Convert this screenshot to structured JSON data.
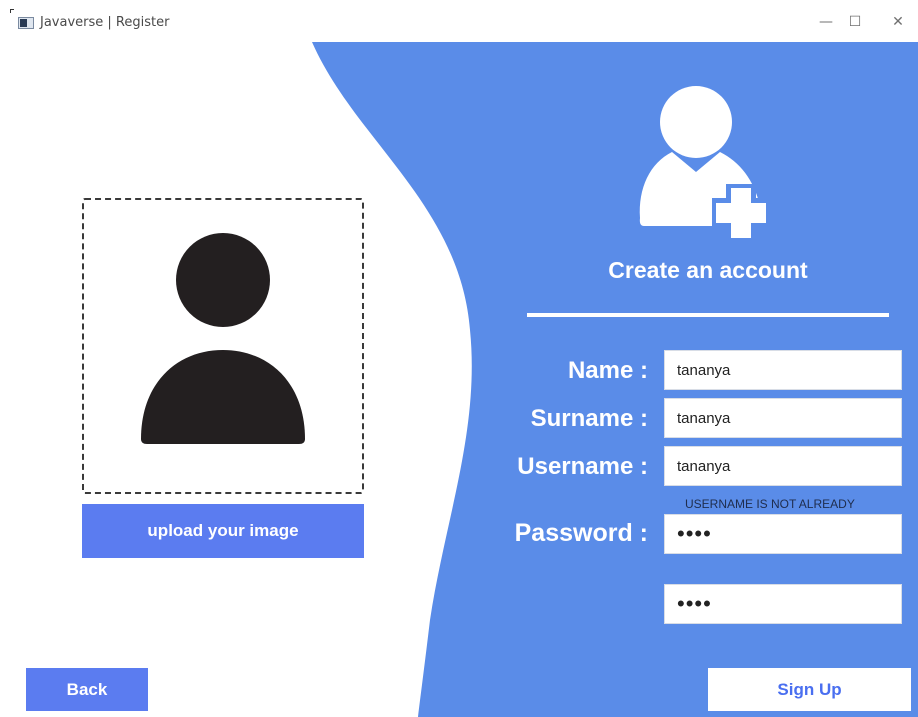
{
  "window": {
    "title": "Javaverse | Register",
    "minimize_glyph": "—",
    "maximize_glyph": "☐",
    "close_glyph": "✕"
  },
  "upload": {
    "button_label": "upload your image"
  },
  "form": {
    "title": "Create an account",
    "name_label": "Name :",
    "name_value": "tananya",
    "surname_label": "Surname :",
    "surname_value": "tananya",
    "username_label": "Username :",
    "username_value": "tananya",
    "username_message": "USERNAME IS NOT ALREADY",
    "password_label": "Password :",
    "password_value": "abcd",
    "confirm_password_value": "abcd"
  },
  "buttons": {
    "back_label": "Back",
    "signup_label": "Sign Up"
  },
  "icons": {
    "app": "app-window-icon",
    "avatar": "user-silhouette-icon",
    "add_user": "add-user-icon"
  },
  "colors": {
    "panel_blue": "#5a8ce8",
    "button_blue": "#5b7cf0",
    "signup_text": "#4a6ff0",
    "avatar_dark": "#231f20"
  }
}
